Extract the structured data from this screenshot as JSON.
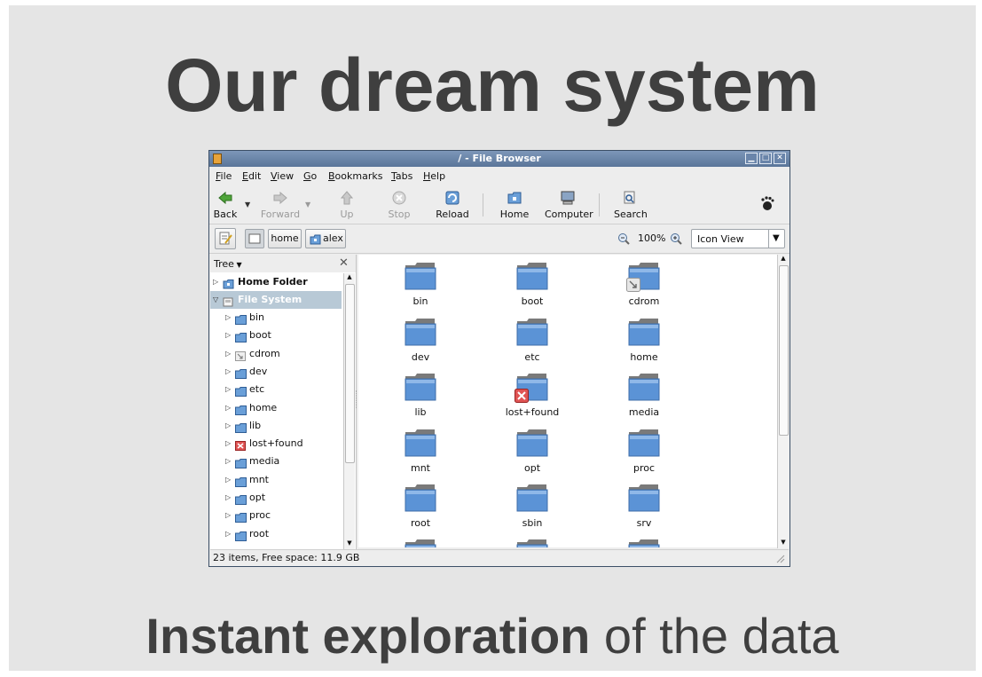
{
  "slide": {
    "title": "Our dream system",
    "subtitle_bold": "Instant exploration",
    "subtitle_rest": " of the data"
  },
  "window": {
    "title": "/ - File Browser",
    "menu": [
      "File",
      "Edit",
      "View",
      "Go",
      "Bookmarks",
      "Tabs",
      "Help"
    ],
    "toolbar": {
      "back": "Back",
      "forward": "Forward",
      "up": "Up",
      "stop": "Stop",
      "reload": "Reload",
      "home": "Home",
      "computer": "Computer",
      "search": "Search"
    },
    "location": {
      "crumbs": [
        "home",
        "alex"
      ],
      "zoom": "100%",
      "view_mode": "Icon View"
    },
    "sidebar": {
      "mode": "Tree",
      "roots": [
        {
          "label": "Home Folder",
          "icon": "home-folder-icon"
        },
        {
          "label": "File System",
          "icon": "drive-icon",
          "selected": true
        }
      ],
      "children": [
        {
          "label": "bin",
          "icon": "folder"
        },
        {
          "label": "boot",
          "icon": "folder"
        },
        {
          "label": "cdrom",
          "icon": "link"
        },
        {
          "label": "dev",
          "icon": "folder"
        },
        {
          "label": "etc",
          "icon": "folder"
        },
        {
          "label": "home",
          "icon": "folder"
        },
        {
          "label": "lib",
          "icon": "folder"
        },
        {
          "label": "lost+found",
          "icon": "locked"
        },
        {
          "label": "media",
          "icon": "folder"
        },
        {
          "label": "mnt",
          "icon": "folder"
        },
        {
          "label": "opt",
          "icon": "folder"
        },
        {
          "label": "proc",
          "icon": "folder"
        },
        {
          "label": "root",
          "icon": "folder"
        }
      ]
    },
    "items": [
      {
        "label": "bin",
        "emblem": ""
      },
      {
        "label": "boot",
        "emblem": ""
      },
      {
        "label": "cdrom",
        "emblem": "link"
      },
      {
        "label": "dev",
        "emblem": ""
      },
      {
        "label": "etc",
        "emblem": ""
      },
      {
        "label": "home",
        "emblem": ""
      },
      {
        "label": "lib",
        "emblem": ""
      },
      {
        "label": "lost+found",
        "emblem": "unreadable"
      },
      {
        "label": "media",
        "emblem": ""
      },
      {
        "label": "mnt",
        "emblem": ""
      },
      {
        "label": "opt",
        "emblem": ""
      },
      {
        "label": "proc",
        "emblem": ""
      },
      {
        "label": "root",
        "emblem": ""
      },
      {
        "label": "sbin",
        "emblem": ""
      },
      {
        "label": "srv",
        "emblem": ""
      }
    ],
    "status": "23 items, Free space: 11.9 GB"
  },
  "colors": {
    "slide_bg": "#e5e5e5",
    "text_dark": "#3f3f3f",
    "titlebar": "#6a85aa",
    "folder_blue": "#5b93d6",
    "selection": "#b8c9d6"
  }
}
